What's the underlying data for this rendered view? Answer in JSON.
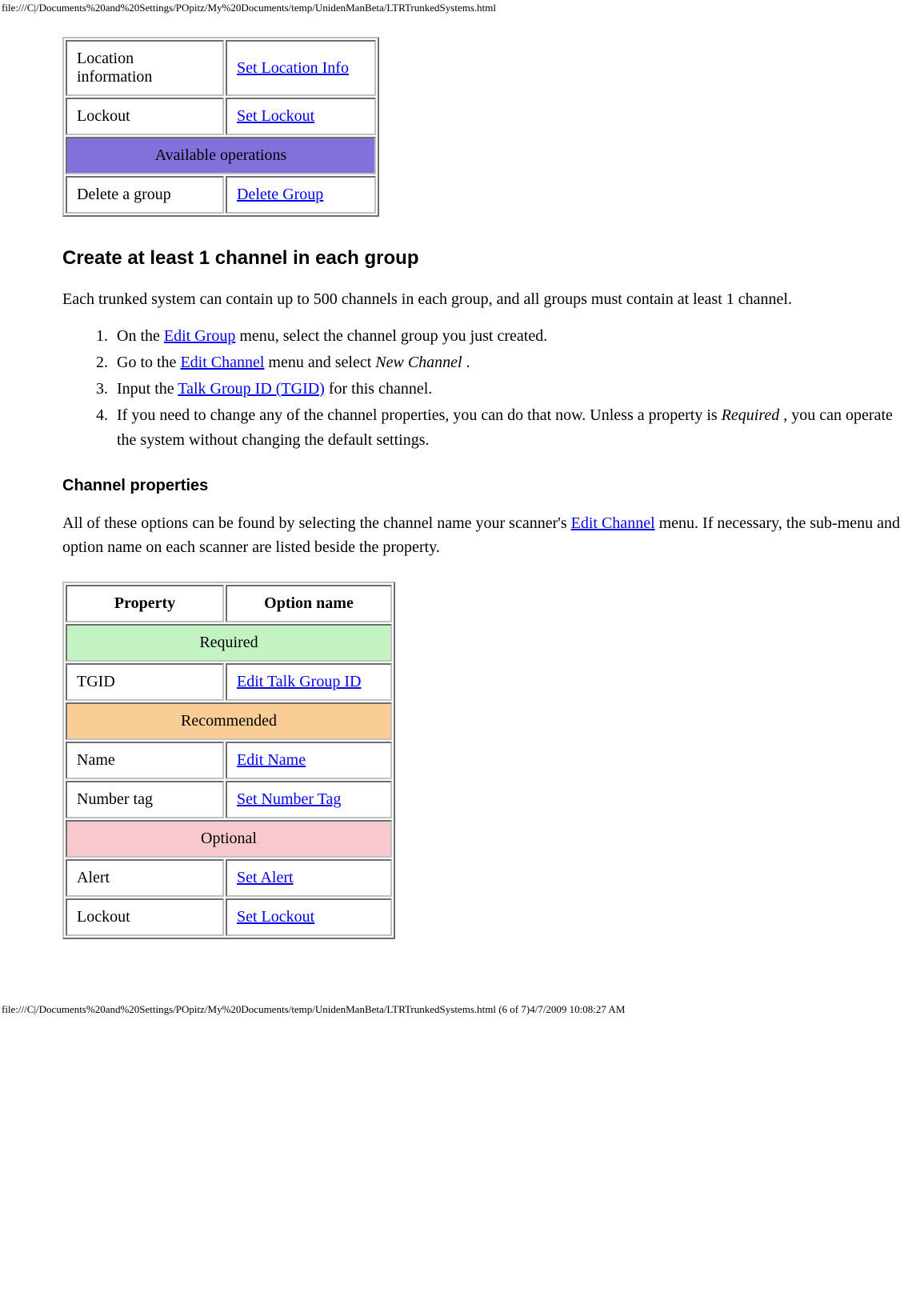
{
  "header_path": "file:///C|/Documents%20and%20Settings/POpitz/My%20Documents/temp/UnidenManBeta/LTRTrunkedSystems.html",
  "footer_path": "file:///C|/Documents%20and%20Settings/POpitz/My%20Documents/temp/UnidenManBeta/LTRTrunkedSystems.html (6 of 7)4/7/2009 10:08:27 AM",
  "table1": {
    "rows": [
      {
        "prop": "Location information",
        "option": "Set Location Info"
      },
      {
        "prop": "Lockout",
        "option": "Set Lockout"
      }
    ],
    "section_available": "Available operations",
    "row_delete": {
      "prop": "Delete a group",
      "option": "Delete Group"
    }
  },
  "heading": "Create at least 1 channel in each group",
  "intro": "Each trunked system can contain up to 500 channels in each group, and all groups must contain at least 1 channel.",
  "steps": {
    "s1a": "On the ",
    "s1link": "Edit Group",
    "s1b": " menu, select the channel group you just created.",
    "s2a": "Go to the ",
    "s2link": "Edit Channel",
    "s2b": " menu and select ",
    "s2em": "New Channel ",
    "s2c": ".",
    "s3a": "Input the ",
    "s3link": "Talk Group ID (TGID)",
    "s3b": " for this channel.",
    "s4a": "If you need to change any of the channel properties, you can do that now. Unless a property is ",
    "s4em": "Required ",
    "s4b": ", you can operate the system without changing the default settings."
  },
  "subheading": "Channel properties",
  "para2a": "All of these options can be found by selecting the channel name your scanner's ",
  "para2link": "Edit Channel",
  "para2b": " menu. If necessary, the sub-menu and option name on each scanner are listed beside the property.",
  "table2": {
    "header_prop": "Property",
    "header_option": "Option name",
    "section_required": "Required",
    "row_tgid": {
      "prop": "TGID",
      "option": "Edit Talk Group ID"
    },
    "section_recommended": "Recommended",
    "row_name": {
      "prop": "Name",
      "option": "Edit Name"
    },
    "row_numtag": {
      "prop": "Number tag",
      "option": "Set Number Tag"
    },
    "section_optional": "Optional",
    "row_alert": {
      "prop": "Alert",
      "option": "Set Alert"
    },
    "row_lockout": {
      "prop": "Lockout",
      "option": "Set Lockout"
    }
  }
}
